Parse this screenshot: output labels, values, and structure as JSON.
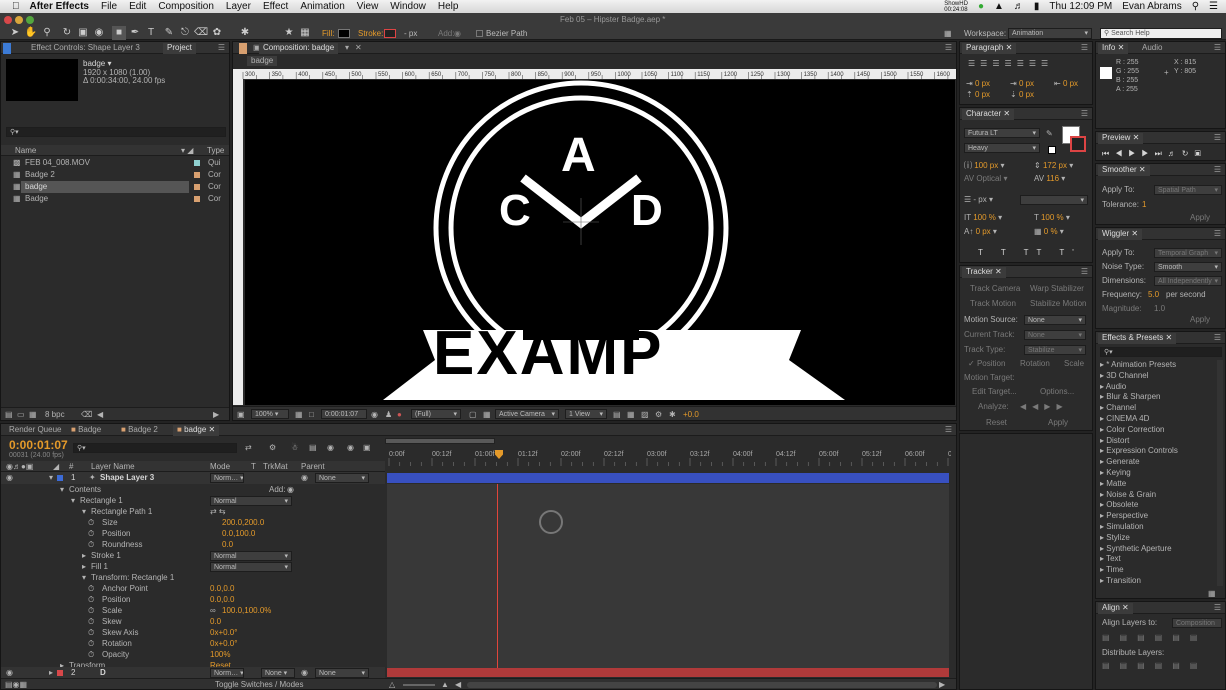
{
  "menubar": {
    "app": "After Effects",
    "items": [
      "File",
      "Edit",
      "Composition",
      "Layer",
      "Effect",
      "Animation",
      "View",
      "Window",
      "Help"
    ],
    "window_title": "Feb 05 – Hipster Badge.aep *",
    "clock": "Thu 12:09 PM",
    "user": "Evan Abrams",
    "record_label": "ShowHD",
    "record_time": "00:24:08"
  },
  "toolbar": {
    "fill_label": "Fill:",
    "stroke_label": "Stroke:",
    "stroke_value": "- px",
    "add_label": "Add:",
    "bezier_label": "Bezier Path",
    "workspace_label": "Workspace:",
    "workspace_value": "Animation",
    "search_placeholder": "Search Help"
  },
  "project": {
    "tab_effect": "Effect Controls: Shape Layer 3",
    "tab_project": "Project",
    "comp_name": "badge ▾",
    "comp_info1": "1920 x 1080 (1.00)",
    "comp_info2": "Δ 0:00:34:00, 24.00 fps",
    "col_name": "Name",
    "col_type": "Type",
    "items": [
      {
        "name": "FEB 04_008.MOV",
        "type": "Qui"
      },
      {
        "name": "Badge 2",
        "type": "Cor"
      },
      {
        "name": "badge",
        "type": "Cor"
      },
      {
        "name": "Badge",
        "type": "Cor"
      }
    ],
    "bpc": "8 bpc"
  },
  "composition": {
    "tab": "Composition: badge",
    "subtab": "badge",
    "badge_letter_top": "A",
    "badge_letter_left": "C",
    "badge_letter_right": "D",
    "banner_text": "EXAMP",
    "ruler_labels": [
      "300",
      "350",
      "400",
      "450",
      "500",
      "550",
      "600",
      "650",
      "700",
      "750",
      "800",
      "850",
      "900",
      "950",
      "1000",
      "1050",
      "1100",
      "1150",
      "1200",
      "1250",
      "1300",
      "1350",
      "1400",
      "1450",
      "1500",
      "1550",
      "1600",
      "1650"
    ],
    "zoom": "100%",
    "timecode": "0:00:01:07",
    "resolution": "(Full)",
    "camera": "Active Camera",
    "view": "1 View",
    "exposure": "+0.0"
  },
  "timeline": {
    "tabs": [
      "Render Queue",
      "Badge",
      "Badge 2",
      "badge"
    ],
    "timecode": "0:00:01:07",
    "frame_info": "00031 (24.00 fps)",
    "col_layer": "Layer Name",
    "col_mode": "Mode",
    "col_t": "T",
    "col_trkmat": "TrkMat",
    "col_parent": "Parent",
    "time_labels": [
      "0:00f",
      "00:12f",
      "01:00f",
      "01:12f",
      "02:00f",
      "02:12f",
      "03:00f",
      "03:12f",
      "04:00f",
      "04:12f",
      "05:00f",
      "05:12f",
      "06:00f",
      "06:1"
    ],
    "add_label": "Add:",
    "layer1": {
      "num": "1",
      "name": "Shape Layer 3",
      "mode": "Norm…",
      "parent": "None"
    },
    "layer2": {
      "num": "2",
      "name": "D",
      "mode": "Norm…",
      "trkmat": "None",
      "parent": "None"
    },
    "props": [
      {
        "indent": 0,
        "label": "Contents",
        "value": "",
        "dd": ""
      },
      {
        "indent": 1,
        "label": "Rectangle 1",
        "value": "",
        "dd": "Normal"
      },
      {
        "indent": 2,
        "label": "Rectangle Path 1",
        "value": "",
        "dd": ""
      },
      {
        "indent": 3,
        "label": "Size",
        "value": "200.0,200.0",
        "dd": ""
      },
      {
        "indent": 3,
        "label": "Position",
        "value": "0.0,100.0",
        "dd": ""
      },
      {
        "indent": 3,
        "label": "Roundness",
        "value": "0.0",
        "dd": ""
      },
      {
        "indent": 2,
        "label": "Stroke 1",
        "value": "",
        "dd": "Normal"
      },
      {
        "indent": 2,
        "label": "Fill 1",
        "value": "",
        "dd": "Normal"
      },
      {
        "indent": 2,
        "label": "Transform: Rectangle 1",
        "value": "",
        "dd": ""
      },
      {
        "indent": 3,
        "label": "Anchor Point",
        "value": "0.0,0.0",
        "dd": ""
      },
      {
        "indent": 3,
        "label": "Position",
        "value": "0.0,0.0",
        "dd": ""
      },
      {
        "indent": 3,
        "label": "Scale",
        "value": "100.0,100.0%",
        "dd": ""
      },
      {
        "indent": 3,
        "label": "Skew",
        "value": "0.0",
        "dd": ""
      },
      {
        "indent": 3,
        "label": "Skew Axis",
        "value": "0x+0.0°",
        "dd": ""
      },
      {
        "indent": 3,
        "label": "Rotation",
        "value": "0x+0.0°",
        "dd": ""
      },
      {
        "indent": 3,
        "label": "Opacity",
        "value": "100%",
        "dd": ""
      },
      {
        "indent": 0,
        "label": "Transform",
        "value": "Reset",
        "dd": ""
      }
    ],
    "toggle_label": "Toggle Switches / Modes"
  },
  "paragraph": {
    "tab": "Paragraph",
    "val1": "0 px",
    "val2": "0 px",
    "val3": "0 px",
    "val4": "0 px",
    "val5": "0 px"
  },
  "character": {
    "tab": "Character",
    "font": "Futura LT",
    "style": "Heavy",
    "size": "100 px",
    "leading": "172 px",
    "kerning": "Optical",
    "tracking": "116",
    "stroke_width": "- px",
    "vscale": "100 %",
    "hscale": "100 %",
    "baseline": "0 px",
    "tsume": "0 %"
  },
  "tracker": {
    "tab": "Tracker",
    "track_camera": "Track Camera",
    "warp_stabilizer": "Warp Stabilizer",
    "track_motion": "Track Motion",
    "stabilize_motion": "Stabilize Motion",
    "motion_source_label": "Motion Source:",
    "motion_source": "None",
    "current_track_label": "Current Track:",
    "current_track": "None",
    "track_type_label": "Track Type:",
    "track_type": "Stabilize",
    "position": "Position",
    "rotation": "Rotation",
    "scale": "Scale",
    "motion_target": "Motion Target:",
    "edit_target": "Edit Target...",
    "options": "Options...",
    "analyze": "Analyze:",
    "reset": "Reset",
    "apply": "Apply"
  },
  "info": {
    "tab_info": "Info",
    "tab_audio": "Audio",
    "r": "R : 255",
    "g": "G : 255",
    "b": "B : 255",
    "a": "A : 255",
    "x": "X : 815",
    "y": "Y : 805"
  },
  "preview": {
    "tab": "Preview"
  },
  "smoother": {
    "tab": "Smoother",
    "apply_to_label": "Apply To:",
    "apply_to": "Spatial Path",
    "tolerance_label": "Tolerance:",
    "tolerance": "1",
    "apply": "Apply"
  },
  "wiggler": {
    "tab": "Wiggler",
    "apply_to_label": "Apply To:",
    "apply_to": "Temporal Graph",
    "noise_label": "Noise Type:",
    "noise": "Smooth",
    "dims_label": "Dimensions:",
    "dims": "All Independently",
    "freq_label": "Frequency:",
    "freq": "5.0",
    "freq_unit": "per second",
    "mag_label": "Magnitude:",
    "mag": "1.0",
    "apply": "Apply"
  },
  "effects": {
    "tab": "Effects & Presets",
    "items": [
      "* Animation Presets",
      "3D Channel",
      "Audio",
      "Blur & Sharpen",
      "Channel",
      "CINEMA 4D",
      "Color Correction",
      "Distort",
      "Expression Controls",
      "Generate",
      "Keying",
      "Matte",
      "Noise & Grain",
      "Obsolete",
      "Perspective",
      "Simulation",
      "Stylize",
      "Synthetic Aperture",
      "Text",
      "Time",
      "Transition"
    ]
  },
  "align": {
    "tab": "Align",
    "align_to_label": "Align Layers to:",
    "align_to": "Composition",
    "distribute_label": "Distribute Layers:"
  }
}
